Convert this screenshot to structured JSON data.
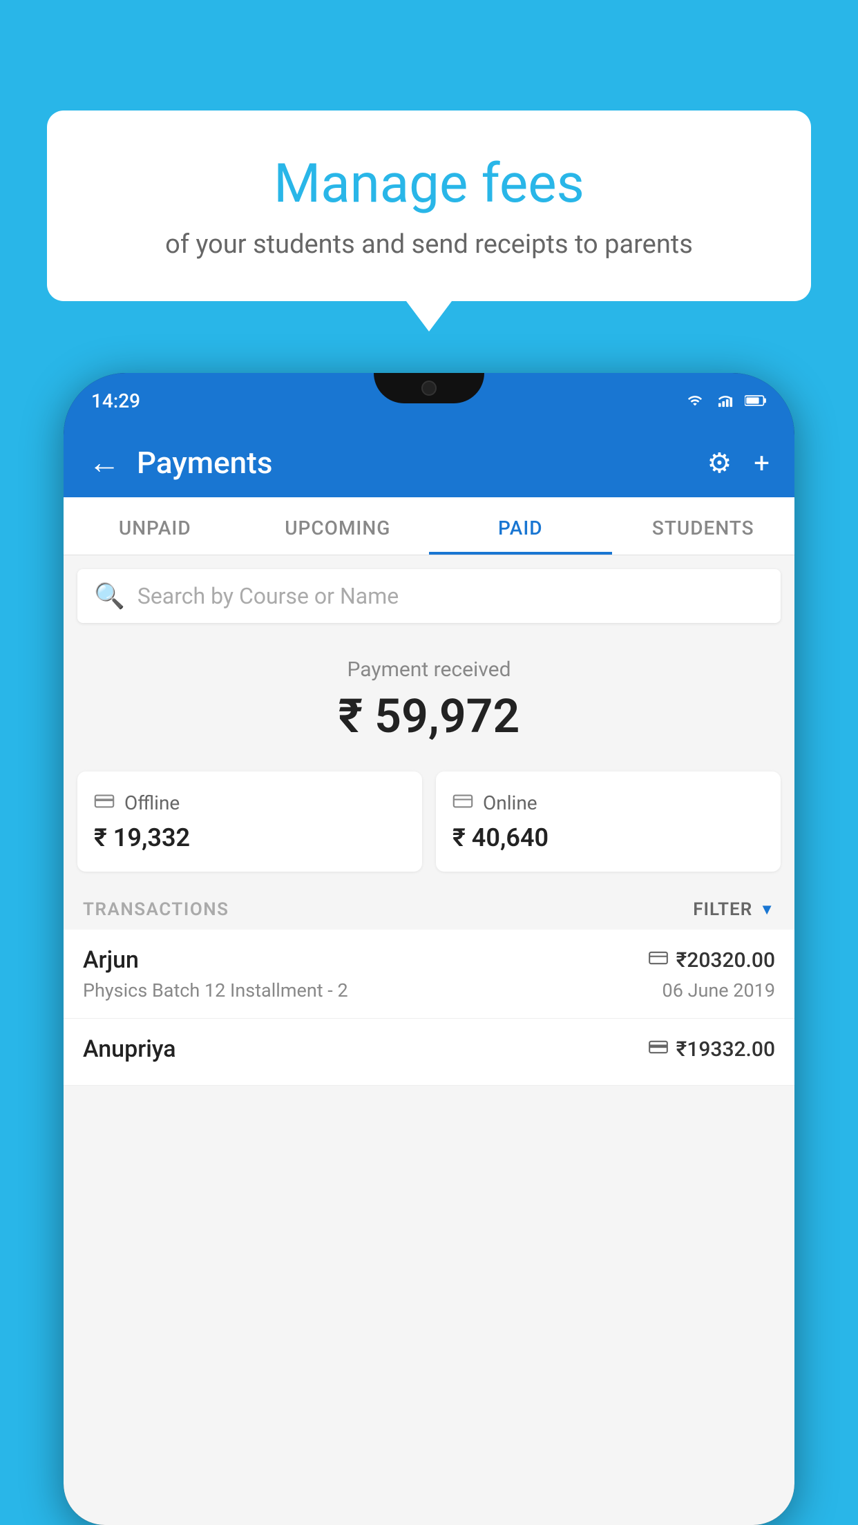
{
  "background_color": "#29b6e8",
  "bubble": {
    "title": "Manage fees",
    "subtitle": "of your students and send receipts to parents"
  },
  "phone": {
    "status_bar": {
      "time": "14:29"
    },
    "header": {
      "title": "Payments",
      "back_label": "←",
      "settings_label": "⚙",
      "add_label": "+"
    },
    "tabs": [
      {
        "label": "UNPAID",
        "active": false
      },
      {
        "label": "UPCOMING",
        "active": false
      },
      {
        "label": "PAID",
        "active": true
      },
      {
        "label": "STUDENTS",
        "active": false
      }
    ],
    "search": {
      "placeholder": "Search by Course or Name"
    },
    "payment_summary": {
      "label": "Payment received",
      "amount": "₹ 59,972"
    },
    "cards": [
      {
        "icon": "💳",
        "label": "Offline",
        "amount": "₹ 19,332"
      },
      {
        "icon": "🪪",
        "label": "Online",
        "amount": "₹ 40,640"
      }
    ],
    "transactions_label": "TRANSACTIONS",
    "filter_label": "FILTER",
    "transactions": [
      {
        "name": "Arjun",
        "payment_type": "online",
        "amount": "₹20320.00",
        "course": "Physics Batch 12 Installment - 2",
        "date": "06 June 2019"
      },
      {
        "name": "Anupriya",
        "payment_type": "offline",
        "amount": "₹19332.00",
        "course": "",
        "date": ""
      }
    ]
  }
}
